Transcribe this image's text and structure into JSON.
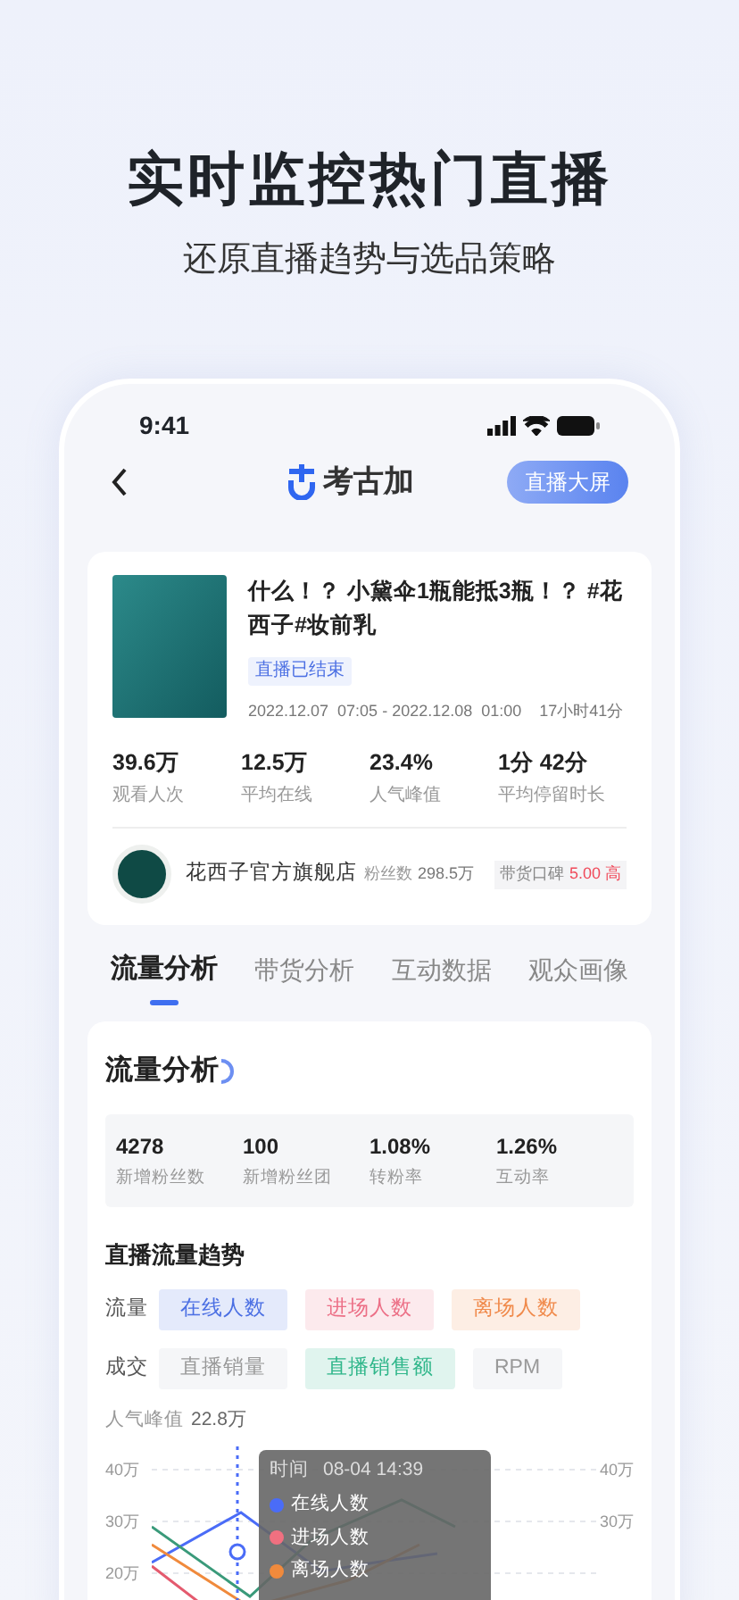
{
  "hero": {
    "title": "实时监控热门直播",
    "subtitle": "还原直播趋势与选品策略"
  },
  "status_bar": {
    "time": "9:41"
  },
  "nav": {
    "logo_text": "考古加",
    "button": "直播大屏"
  },
  "live": {
    "title": "什么！？ 小黛伞1瓶能抵3瓶！？ #花西子#妆前乳",
    "status": "直播已结束",
    "time_range": "2022.12.07  07:05 - 2022.12.08  01:00",
    "duration": "17小时41分",
    "stats": [
      {
        "value": "39.6万",
        "label": "观看人次"
      },
      {
        "value": "12.5万",
        "label": "平均在线"
      },
      {
        "value": "23.4%",
        "label": "人气峰值"
      },
      {
        "value": "1分 42分",
        "label": "平均停留时长"
      }
    ]
  },
  "shop": {
    "name": "花西子官方旗舰店",
    "fans_label": "粉丝数",
    "fans": "298.5万",
    "rating_label": "带货口碑",
    "rating": "5.00 高"
  },
  "tabs": [
    {
      "label": "流量分析",
      "selected": true
    },
    {
      "label": "带货分析",
      "selected": false
    },
    {
      "label": "互动数据",
      "selected": false
    },
    {
      "label": "观众画像",
      "selected": false
    }
  ],
  "analysis": {
    "title": "流量分析",
    "stats": [
      {
        "value": "4278",
        "label": "新增粉丝数"
      },
      {
        "value": "100",
        "label": "新增粉丝团"
      },
      {
        "value": "1.08%",
        "label": "转粉率"
      },
      {
        "value": "1.26%",
        "label": "互动率"
      }
    ],
    "trend_title": "直播流量趋势",
    "filter_groups": [
      {
        "label": "流量",
        "chips": [
          {
            "label": "在线人数",
            "selected": true,
            "color": "#4b6fe3"
          },
          {
            "label": "进场人数",
            "selected": true,
            "color": "#ec6f86"
          },
          {
            "label": "离场人数",
            "selected": true,
            "color": "#f08a4b"
          }
        ]
      },
      {
        "label": "成交",
        "chips": [
          {
            "label": "直播销量",
            "selected": false
          },
          {
            "label": "直播销售额",
            "selected": true,
            "color": "#2fb68a"
          },
          {
            "label": "RPM",
            "selected": false
          }
        ]
      }
    ],
    "peak_label": "人气峰值",
    "peak_value": "22.8万",
    "chart": {
      "y_ticks_left": [
        "40万",
        "30万",
        "20万"
      ],
      "y_ticks_right": [
        "40万",
        "30万"
      ],
      "tooltip": {
        "time_label": "时间",
        "time": "08-04 14:39",
        "items": [
          {
            "label": "在线人数",
            "color": "#4a6cf7"
          },
          {
            "label": "进场人数",
            "color": "#f07080"
          },
          {
            "label": "离场人数",
            "color": "#f08a3c"
          }
        ]
      }
    }
  }
}
